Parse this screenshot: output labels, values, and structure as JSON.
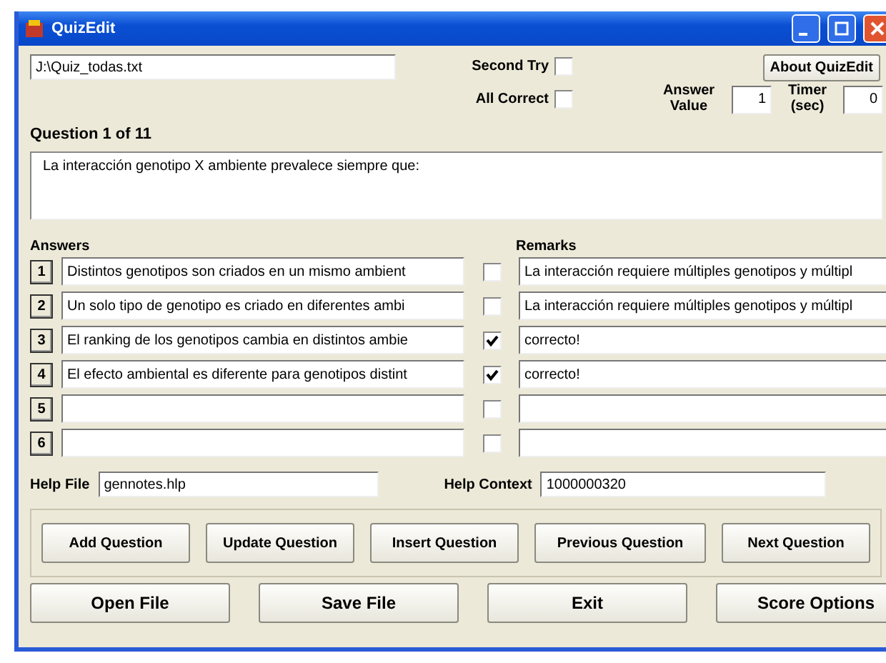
{
  "window": {
    "title": "QuizEdit"
  },
  "file_path": "J:\\Quiz_todas.txt",
  "options": [
    {
      "label": "Second Try",
      "checked": false
    },
    {
      "label": "All Correct",
      "checked": false
    }
  ],
  "about_button": "About QuizEdit",
  "answer_value": {
    "label": "Answer Value",
    "value": "1"
  },
  "timer": {
    "label": "Timer (sec)",
    "value": "0"
  },
  "question_counter": "Question  1  of  11",
  "question_text": "La interacción genotipo X ambiente prevalece siempre que:",
  "answers_heading": "Answers",
  "remarks_heading": "Remarks",
  "answers": [
    {
      "number": "1",
      "text": "Distintos genotipos son criados en un mismo ambient",
      "correct": false,
      "remark": "La interacción requiere múltiples genotipos y múltipl"
    },
    {
      "number": "2",
      "text": "Un solo tipo de genotipo es criado en diferentes ambi",
      "correct": false,
      "remark": "La interacción requiere múltiples genotipos y múltipl"
    },
    {
      "number": "3",
      "text": "El ranking de los genotipos cambia en distintos ambie",
      "correct": true,
      "remark": "correcto!"
    },
    {
      "number": "4",
      "text": "El efecto ambiental es diferente para genotipos distint",
      "correct": true,
      "remark": "correcto!"
    },
    {
      "number": "5",
      "correct": false
    },
    {
      "number": "6",
      "correct": false
    }
  ],
  "help_file": {
    "label": "Help File",
    "value": "gennotes.hlp"
  },
  "help_context": {
    "label": "Help Context",
    "value": "1000000320"
  },
  "question_buttons": [
    "Add Question",
    "Update Question",
    "Insert Question",
    "Previous Question",
    "Next Question"
  ],
  "file_buttons": [
    "Open File",
    "Save File",
    "Exit",
    "Score Options"
  ]
}
